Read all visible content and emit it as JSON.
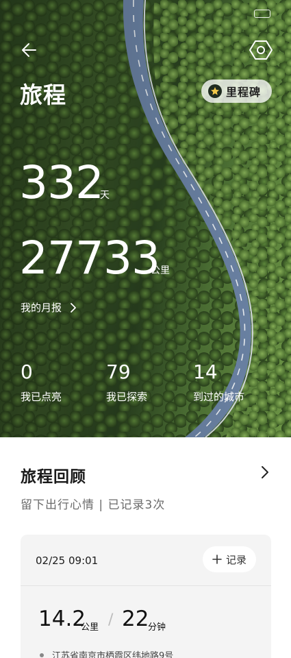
{
  "status_bar": {
    "time": "",
    "battery": ""
  },
  "header": {
    "title": "旅程",
    "milestone_label": "里程碑"
  },
  "summary": {
    "days_value": "332",
    "days_unit": "天",
    "distance_value": "27733",
    "distance_unit": "公里",
    "monthly_report_label": "我的月报"
  },
  "stats": [
    {
      "value": "0",
      "label": "我已点亮"
    },
    {
      "value": "79",
      "label": "我已探索"
    },
    {
      "value": "14",
      "label": "到过的城市"
    }
  ],
  "review": {
    "title": "旅程回顾",
    "subtitle": "留下出行心情 | 已记录3次"
  },
  "trip": {
    "datetime": "02/25 09:01",
    "record_label": "记录",
    "distance_value": "14.2",
    "distance_unit": "公里",
    "separator": "/",
    "duration_value": "22",
    "duration_unit": "分钟",
    "address": "江苏省南京市栖霞区纬地路9号"
  },
  "icons": {
    "back": "arrow-left-icon",
    "settings": "hexagon-settings-icon",
    "milestone": "star-icon",
    "chevron": "chevron-right-icon",
    "plus": "plus-icon"
  },
  "colors": {
    "text_light": "#ffffff",
    "card_bg": "#f4f4f4",
    "muted": "#6b6b6b"
  }
}
